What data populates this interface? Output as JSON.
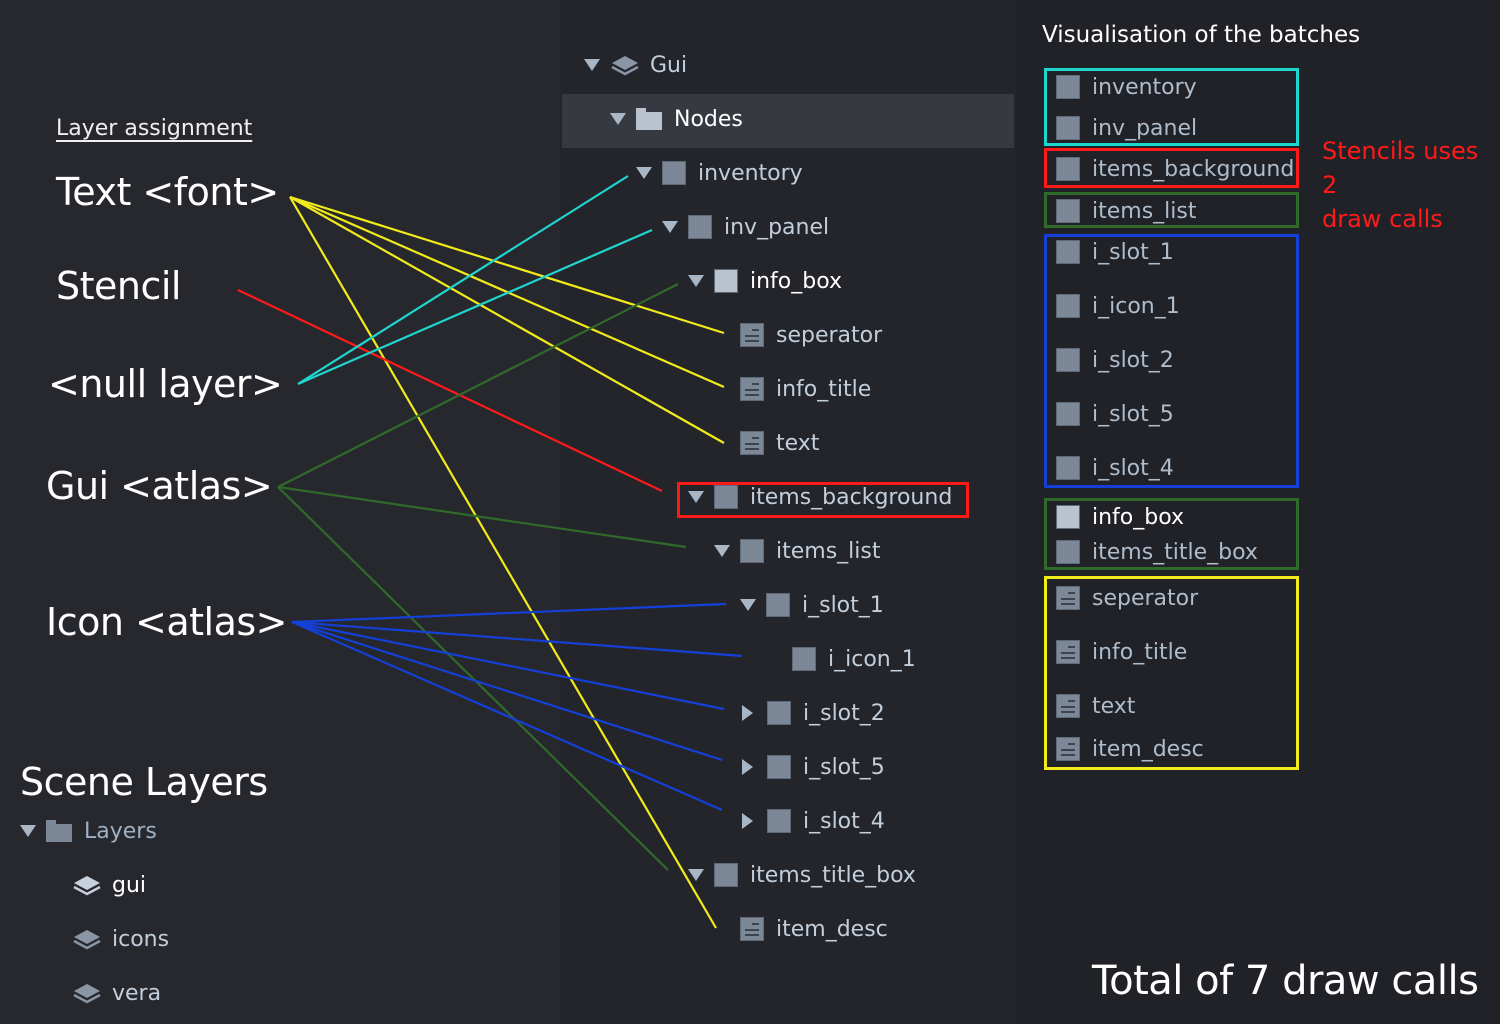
{
  "layer_assignment": {
    "title": "Layer assignment",
    "labels": [
      {
        "id": "text_font",
        "text": "Text <font>",
        "color": "#f2eb1c"
      },
      {
        "id": "stencil",
        "text": "Stencil",
        "color": "#ff1a1a"
      },
      {
        "id": "null_layer",
        "text": "<null layer>",
        "color": "#1fd6cf"
      },
      {
        "id": "gui_atlas",
        "text": "Gui <atlas>",
        "color": "#2f6a2a"
      },
      {
        "id": "icon_atlas",
        "text": "Icon <atlas>",
        "color": "#1440d8"
      }
    ]
  },
  "node_tree": {
    "root": {
      "label": "Gui",
      "icon": "layers-icon",
      "expanded": true
    },
    "group": {
      "label": "Nodes",
      "icon": "folder-icon",
      "expanded": true,
      "selected": true
    },
    "nodes": [
      {
        "label": "inventory",
        "icon": "box-icon",
        "toggle": "expanded",
        "depth": 0
      },
      {
        "label": "inv_panel",
        "icon": "box-icon",
        "toggle": "expanded",
        "depth": 1
      },
      {
        "label": "info_box",
        "icon": "box-icon",
        "toggle": "expanded",
        "depth": 2,
        "highlight": true
      },
      {
        "label": "seperator",
        "icon": "text-node-icon",
        "toggle": "none",
        "depth": 3
      },
      {
        "label": "info_title",
        "icon": "text-node-icon",
        "toggle": "none",
        "depth": 3
      },
      {
        "label": "text",
        "icon": "text-node-icon",
        "toggle": "none",
        "depth": 3
      },
      {
        "label": "items_background",
        "icon": "box-icon",
        "toggle": "expanded",
        "depth": 2,
        "outlined": true
      },
      {
        "label": "items_list",
        "icon": "box-icon",
        "toggle": "expanded",
        "depth": 3
      },
      {
        "label": "i_slot_1",
        "icon": "box-icon",
        "toggle": "expanded",
        "depth": 4
      },
      {
        "label": "i_icon_1",
        "icon": "box-icon",
        "toggle": "none",
        "depth": 5
      },
      {
        "label": "i_slot_2",
        "icon": "box-icon",
        "toggle": "collapsed",
        "depth": 4
      },
      {
        "label": "i_slot_5",
        "icon": "box-icon",
        "toggle": "collapsed",
        "depth": 4
      },
      {
        "label": "i_slot_4",
        "icon": "box-icon",
        "toggle": "collapsed",
        "depth": 4
      },
      {
        "label": "items_title_box",
        "icon": "box-icon",
        "toggle": "expanded",
        "depth": 2
      },
      {
        "label": "item_desc",
        "icon": "text-node-icon",
        "toggle": "none",
        "depth": 3
      }
    ]
  },
  "connections": [
    {
      "from": "text_font",
      "to": "seperator"
    },
    {
      "from": "text_font",
      "to": "info_title"
    },
    {
      "from": "text_font",
      "to": "text"
    },
    {
      "from": "text_font",
      "to": "item_desc"
    },
    {
      "from": "stencil",
      "to": "items_background"
    },
    {
      "from": "null_layer",
      "to": "inventory"
    },
    {
      "from": "null_layer",
      "to": "inv_panel"
    },
    {
      "from": "gui_atlas",
      "to": "info_box"
    },
    {
      "from": "gui_atlas",
      "to": "items_list"
    },
    {
      "from": "gui_atlas",
      "to": "items_title_box"
    },
    {
      "from": "icon_atlas",
      "to": "i_slot_1"
    },
    {
      "from": "icon_atlas",
      "to": "i_icon_1"
    },
    {
      "from": "icon_atlas",
      "to": "i_slot_2"
    },
    {
      "from": "icon_atlas",
      "to": "i_slot_5"
    },
    {
      "from": "icon_atlas",
      "to": "i_slot_4"
    }
  ],
  "scene_layers": {
    "title": "Scene Layers",
    "folder": "Layers",
    "layers": [
      {
        "label": "gui",
        "active": true
      },
      {
        "label": "icons",
        "active": false
      },
      {
        "label": "vera",
        "active": false
      }
    ]
  },
  "batches": {
    "title": "Visualisation of the batches",
    "groups": [
      {
        "color": "#1fd6cf",
        "items": [
          {
            "label": "inventory",
            "icon": "box-icon"
          },
          {
            "label": "inv_panel",
            "icon": "box-icon"
          }
        ]
      },
      {
        "color": "#ff1a1a",
        "items": [
          {
            "label": "items_background",
            "icon": "box-icon"
          }
        ]
      },
      {
        "color": "#2f6a2a",
        "items": [
          {
            "label": "items_list",
            "icon": "box-icon"
          }
        ]
      },
      {
        "color": "#1440d8",
        "items": [
          {
            "label": "i_slot_1",
            "icon": "box-icon"
          },
          {
            "label": "i_icon_1",
            "icon": "box-icon"
          },
          {
            "label": "i_slot_2",
            "icon": "box-icon"
          },
          {
            "label": "i_slot_5",
            "icon": "box-icon"
          },
          {
            "label": "i_slot_4",
            "icon": "box-icon"
          }
        ]
      },
      {
        "color": "#2f6a2a",
        "items": [
          {
            "label": "info_box",
            "icon": "box-icon",
            "bright": true
          },
          {
            "label": "items_title_box",
            "icon": "box-icon"
          }
        ]
      },
      {
        "color": "#f2eb1c",
        "items": [
          {
            "label": "seperator",
            "icon": "text-node-icon"
          },
          {
            "label": "info_title",
            "icon": "text-node-icon"
          },
          {
            "label": "text",
            "icon": "text-node-icon"
          },
          {
            "label": "item_desc",
            "icon": "text-node-icon"
          }
        ]
      }
    ],
    "stencil_note_line1": "Stencils uses 2",
    "stencil_note_line2": "draw calls",
    "total": "Total of 7 draw calls"
  }
}
